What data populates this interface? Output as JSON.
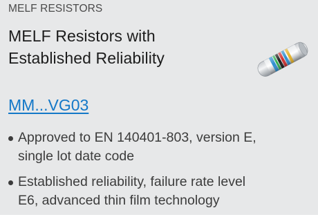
{
  "card": {
    "category": "MELF RESISTORS",
    "title_line1": "MELF Resistors with",
    "title_line2": "Established Reliability",
    "part_link": "MM...VG03",
    "bullets": [
      {
        "line1": "Approved to EN 140401-803, version E,",
        "line2": "single lot date code"
      },
      {
        "line1": "Established reliability, failure rate level",
        "line2": "E6, advanced thin film technology"
      }
    ],
    "image_icon": "melf-resistor-image"
  },
  "colors": {
    "background": "#e7e8e9",
    "link": "#1478c8",
    "text": "#3c3c3c",
    "title": "#1c1c1c"
  }
}
